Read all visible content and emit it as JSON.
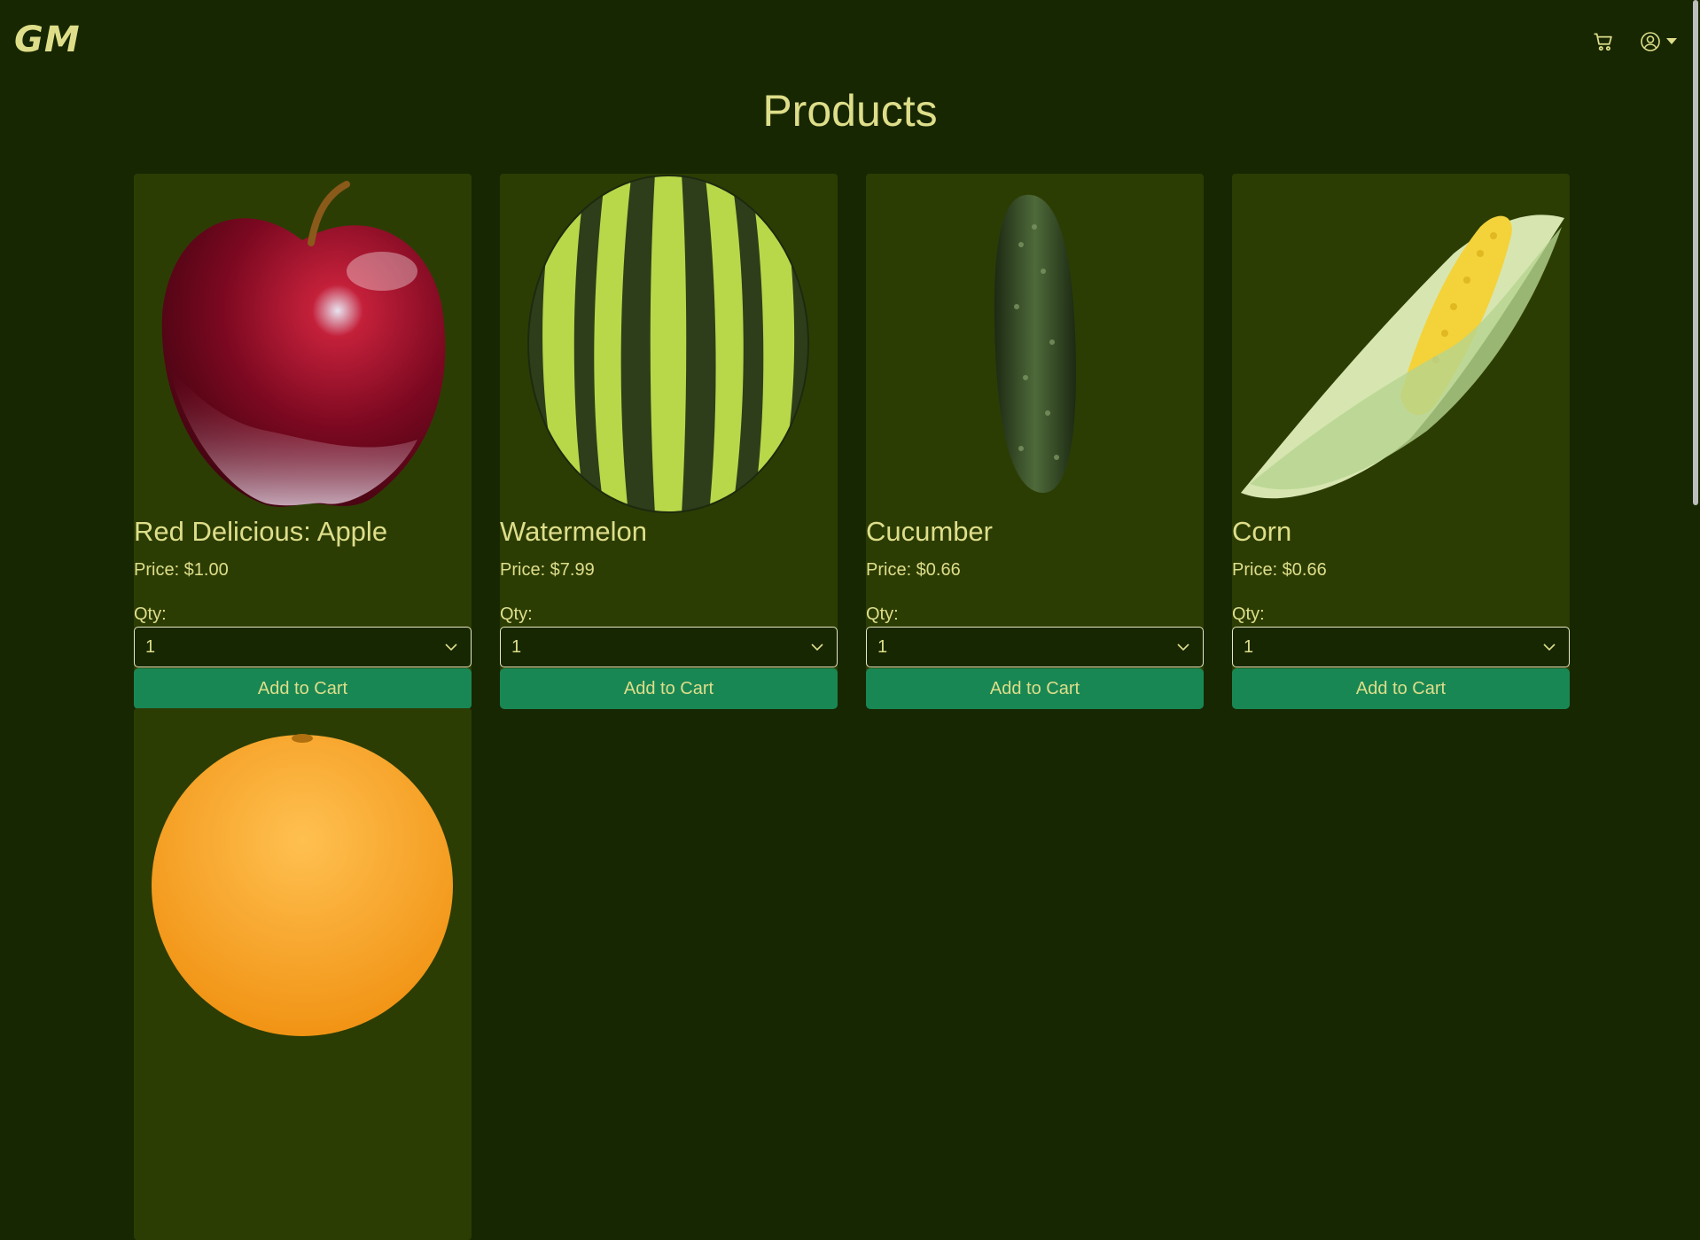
{
  "navbar": {
    "brand": "GM",
    "cart_icon": "shopping-cart-icon",
    "user_icon": "user-circle-icon",
    "dropdown_icon": "caret-down-icon"
  },
  "page": {
    "title": "Products"
  },
  "colors": {
    "background": "#172702",
    "card": "#2c3d04",
    "text": "#dede8a",
    "button": "#198754"
  },
  "products": [
    {
      "name": "Red Delicious: Apple",
      "price": "Price: $1.00",
      "qty_label": "Qty:",
      "qty_value": "1",
      "button_label": "Add to Cart",
      "image_icon": "apple-image"
    },
    {
      "name": "Watermelon",
      "price": "Price: $7.99",
      "qty_label": "Qty:",
      "qty_value": "1",
      "button_label": "Add to Cart",
      "image_icon": "watermelon-image"
    },
    {
      "name": "Cucumber",
      "price": "Price: $0.66",
      "qty_label": "Qty:",
      "qty_value": "1",
      "button_label": "Add to Cart",
      "image_icon": "cucumber-image"
    },
    {
      "name": "Corn",
      "price": "Price: $0.66",
      "qty_label": "Qty:",
      "qty_value": "1",
      "button_label": "Add to Cart",
      "image_icon": "corn-image"
    },
    {
      "name": "",
      "price": "",
      "qty_label": "",
      "qty_value": "",
      "button_label": "",
      "image_icon": "orange-image"
    }
  ]
}
